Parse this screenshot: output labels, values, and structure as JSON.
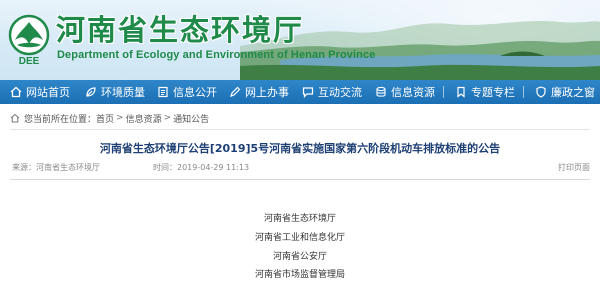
{
  "header": {
    "title": "河南省生态环境厅",
    "subtitle": "Department of Ecology and Environment of Henan Province",
    "logo_text": "DEE",
    "colors": {
      "title": "#1f8a4a",
      "nav": "#1b6fb4",
      "article_title": "#1d3f74"
    }
  },
  "nav": {
    "items": [
      {
        "label": "网站首页",
        "icon": "home-icon"
      },
      {
        "label": "环境质量",
        "icon": "leaf-icon"
      },
      {
        "label": "信息公开",
        "icon": "document-icon"
      },
      {
        "label": "网上办事",
        "icon": "pen-icon"
      },
      {
        "label": "互动交流",
        "icon": "chat-icon"
      },
      {
        "label": "信息资源",
        "icon": "database-icon"
      },
      {
        "label": "专题专栏",
        "icon": "bookmark-icon"
      },
      {
        "label": "廉政之窗",
        "icon": "shield-icon"
      }
    ]
  },
  "breadcrumb": {
    "prefix": "您当前所在位置：",
    "items": [
      "首页",
      "信息资源",
      "通知公告"
    ],
    "separator": ">"
  },
  "article": {
    "title": "河南省生态环境厅公告[2019]5号河南省实施国家第六阶段机动车排放标准的公告",
    "source": "来源：河南省生态环境厅",
    "time": "时间：2019-04-29 11:13",
    "print_label": "打印页面",
    "body": [
      "河南省生态环境厅",
      "河南省工业和信息化厅",
      "河南省公安厅",
      "河南省市场监督管理局"
    ]
  }
}
